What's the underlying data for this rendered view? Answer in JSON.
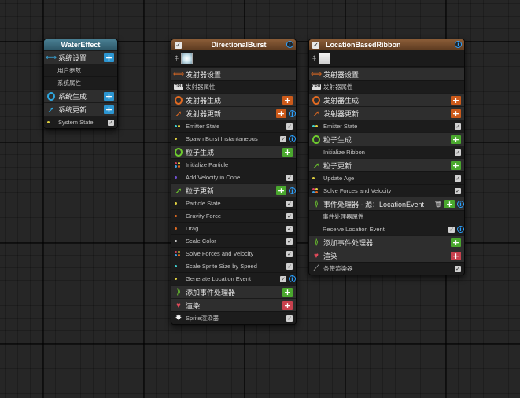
{
  "nodes": {
    "water_effect": {
      "title": "WaterEffect",
      "system_settings": "系统设置",
      "user_params": "用户参数",
      "system_props": "系统属性",
      "system_spawn": "系统生成",
      "system_update": "系统更新",
      "system_state": "System State"
    },
    "directional_burst": {
      "title": "DirectionalBurst",
      "emitter_settings": "发射器设置",
      "emitter_props": "发射器属性",
      "emitter_spawn": "发射器生成",
      "emitter_update": "发射器更新",
      "emitter_state": "Emitter State",
      "spawn_burst": "Spawn Burst Instantaneous",
      "particle_spawn": "粒子生成",
      "initialize_particle": "Initialize Particle",
      "add_velocity_cone": "Add Velocity in Cone",
      "particle_update": "粒子更新",
      "particle_state": "Particle State",
      "gravity_force": "Gravity Force",
      "drag": "Drag",
      "scale_color": "Scale Color",
      "solve_forces": "Solve Forces and Velocity",
      "scale_sprite": "Scale Sprite Size by Speed",
      "generate_location_event": "Generate Location Event",
      "add_event_handler": "添加事件处理器",
      "render": "渲染",
      "sprite_renderer": "Sprite渲染器"
    },
    "location_based_ribbon": {
      "title": "LocationBasedRibbon",
      "emitter_settings": "发射器设置",
      "emitter_props": "发射器属性",
      "emitter_spawn": "发射器生成",
      "emitter_update": "发射器更新",
      "emitter_state": "Emitter State",
      "particle_spawn": "粒子生成",
      "initialize_ribbon": "Initialize Ribbon",
      "particle_update": "粒子更新",
      "update_age": "Update Age",
      "solve_forces": "Solve Forces and Velocity",
      "event_handler": "事件处理器 - 源：LocationEvent",
      "event_handler_props": "事件处理器属性",
      "receive_location_event": "Receive Location Event",
      "add_event_handler": "添加事件处理器",
      "render": "渲染",
      "ribbon_renderer": "条带渲染器"
    }
  },
  "colors": {
    "system_header": "#3c6e80",
    "emitter_header": "#7a4f2e",
    "add_blue": "#2c96d2",
    "add_orange": "#cc5a1a",
    "add_green": "#4aa82e",
    "add_red": "#c8414e",
    "info_blue": "#2aa0ff"
  }
}
